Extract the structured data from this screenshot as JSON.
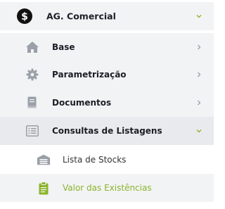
{
  "colors": {
    "accent": "#8cb52a",
    "text_dark": "#1d1d26",
    "icon_gray": "#9aa0a8",
    "row_bg": "#f2f3f5"
  },
  "menu": {
    "root": {
      "label": "AG. Comercial",
      "icon": "dollar-circle-icon",
      "expanded": true
    },
    "items": [
      {
        "label": "Base",
        "icon": "home-icon"
      },
      {
        "label": "Parametrização",
        "icon": "gear-icon"
      },
      {
        "label": "Documentos",
        "icon": "document-icon"
      },
      {
        "label": "Consultas de Listagens",
        "icon": "list-icon",
        "expanded": true
      }
    ],
    "subitems": [
      {
        "label": "Lista de Stocks",
        "icon": "warehouse-icon"
      },
      {
        "label": "Valor das Existências",
        "icon": "clipboard-icon",
        "active": true
      }
    ]
  }
}
